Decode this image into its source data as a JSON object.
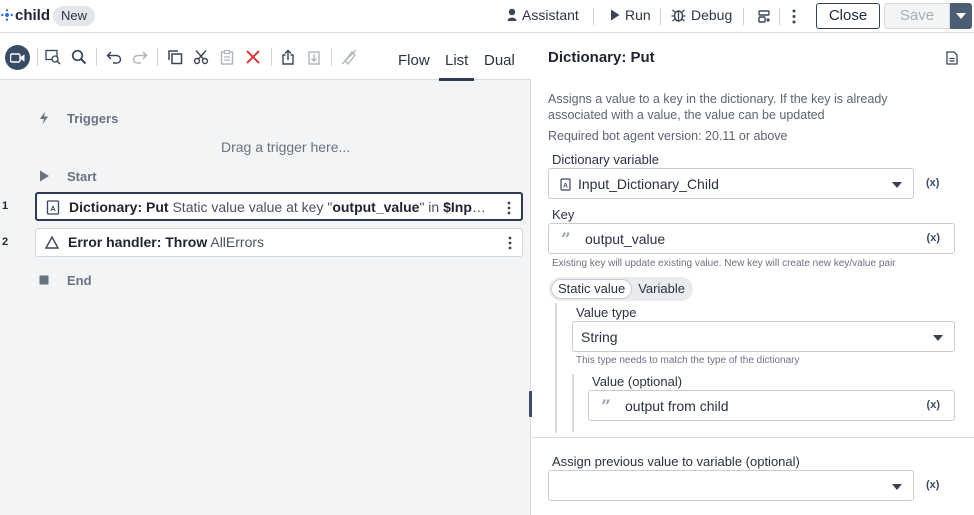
{
  "header": {
    "title": "child",
    "badge": "New",
    "assistant_label": "Assistant",
    "run_label": "Run",
    "debug_label": "Debug",
    "close_label": "Close",
    "save_label": "Save"
  },
  "editor": {
    "view_tabs": [
      {
        "label": "Flow",
        "active": false
      },
      {
        "label": "List",
        "active": true
      },
      {
        "label": "Dual",
        "active": false
      }
    ],
    "triggers_label": "Triggers",
    "drag_hint": "Drag a trigger here...",
    "start_label": "Start",
    "end_label": "End",
    "steps": [
      {
        "line": "1",
        "name": "Dictionary: Put",
        "text_pre": "Static value value at key \"",
        "key": "output_value",
        "text_mid": "\" in ",
        "variable": "$Input_Di...",
        "icon": "dictionary-icon",
        "selected": true
      },
      {
        "line": "2",
        "name": "Error handler: Throw",
        "detail": "AllErrors",
        "icon": "triangle-icon",
        "selected": false
      }
    ]
  },
  "properties": {
    "title": "Dictionary: Put",
    "description": "Assigns a value to a key in the dictionary. If the key is already associated with a value, the value can be updated",
    "required_version": "Required bot agent version: 20.11 or above",
    "dictionary_variable": {
      "label": "Dictionary variable",
      "value": "Input_Dictionary_Child"
    },
    "key": {
      "label": "Key",
      "value": "output_value",
      "hint": "Existing key will update existing value. New key will create new key/value pair"
    },
    "value_source": {
      "options": [
        "Static value",
        "Variable"
      ],
      "selected": "Static value"
    },
    "value_type": {
      "label": "Value type",
      "value": "String",
      "hint": "This type needs to match the type of the dictionary"
    },
    "value": {
      "label": "Value (optional)",
      "value": "output from child"
    },
    "assign_previous": {
      "label": "Assign previous value to variable (optional)",
      "value": ""
    },
    "var_badge": "(x)"
  },
  "colors": {
    "accent": "#3a4b66",
    "selected_border": "#2c3a52",
    "panel_bg": "#f3f4f6"
  }
}
